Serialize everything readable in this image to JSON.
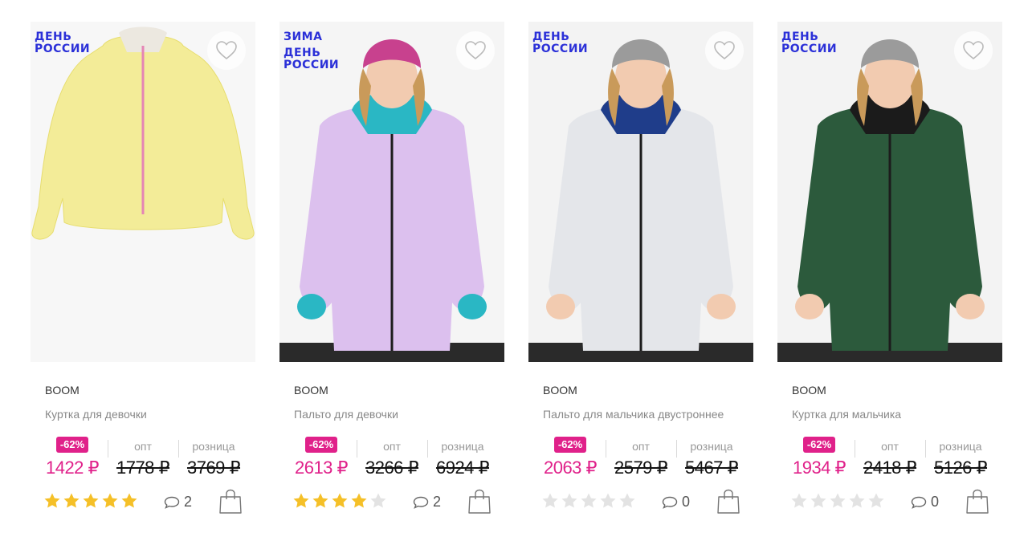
{
  "products": [
    {
      "badges": [
        "ДЕНЬ\nРОССИИ"
      ],
      "brand": "BOOM",
      "title": "Куртка для девочки",
      "discount": "-62%",
      "price_label_opt": "опт",
      "price_label_retail": "розница",
      "price_sale": "1422 ₽",
      "price_opt": "1778 ₽",
      "price_retail": "3769 ₽",
      "rating": 5,
      "comments": "2",
      "photo": {
        "bg": "#f7f7f7",
        "garment": "#f3ec98",
        "accent": "#e585b5",
        "kid": false
      }
    },
    {
      "badges": [
        "ЗИМА",
        "ДЕНЬ\nРОССИИ"
      ],
      "brand": "BOOM",
      "title": "Пальто для девочки",
      "discount": "-62%",
      "price_label_opt": "опт",
      "price_label_retail": "розница",
      "price_sale": "2613 ₽",
      "price_opt": "3266 ₽",
      "price_retail": "6924 ₽",
      "rating": 4,
      "comments": "2",
      "photo": {
        "bg": "#f5f5f5",
        "garment": "#dcc0ee",
        "accent": "#2ab7c4",
        "hat": "#c8418e",
        "kid": true
      }
    },
    {
      "badges": [
        "ДЕНЬ\nРОССИИ"
      ],
      "brand": "BOOM",
      "title": "Пальто для мальчика двустроннее",
      "discount": "-62%",
      "price_label_opt": "опт",
      "price_label_retail": "розница",
      "price_sale": "2063 ₽",
      "price_opt": "2579 ₽",
      "price_retail": "5467 ₽",
      "rating": 0,
      "comments": "0",
      "photo": {
        "bg": "#f3f3f3",
        "garment": "#e4e6ea",
        "accent": "#1f3d8a",
        "hat": "#9b9b9b",
        "kid": true
      }
    },
    {
      "badges": [
        "ДЕНЬ\nРОССИИ"
      ],
      "brand": "BOOM",
      "title": "Куртка для мальчика",
      "discount": "-62%",
      "price_label_opt": "опт",
      "price_label_retail": "розница",
      "price_sale": "1934 ₽",
      "price_opt": "2418 ₽",
      "price_retail": "5126 ₽",
      "rating": 0,
      "comments": "0",
      "photo": {
        "bg": "#f3f3f3",
        "garment": "#2c5a3c",
        "accent": "#1b1b1b",
        "hat": "#9b9b9b",
        "kid": true
      }
    }
  ],
  "colors": {
    "badge": "#2b30d8",
    "sale": "#e0218a",
    "star_on": "#f5c028",
    "star_off": "#e3e3e3"
  },
  "icons": {
    "favorite": "heart-icon",
    "comments": "comment-bubble-icon",
    "cart": "shopping-bag-icon",
    "rating": "star-icon"
  }
}
